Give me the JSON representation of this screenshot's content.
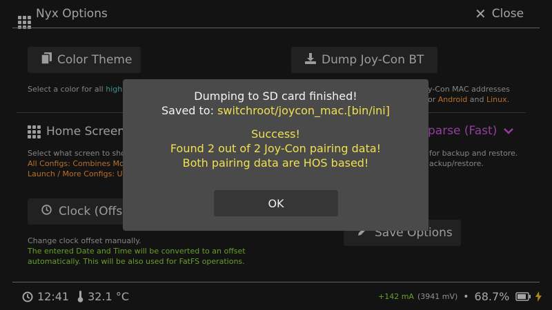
{
  "header": {
    "title": "Nyx Options",
    "close_label": "Close"
  },
  "buttons": {
    "color_theme": "Color Theme",
    "dump_joycon": "Dump Joy-Con BT",
    "home_screen": "Home Screen",
    "clock": "Clock (Offse",
    "save_options": "Save Options",
    "dropdown_value": "parse (Fast)"
  },
  "descriptions": {
    "color_prefix": "Select a color for all ",
    "color_highlight": "highli",
    "joycon_line1": "y-Con MAC addresses",
    "joycon_line2_prefix": "or ",
    "joycon_android": "Android",
    "joycon_and": " and ",
    "joycon_linux": "Linux",
    "joycon_dot": ".",
    "home_line1": "Select what screen to sho",
    "home_line2": "All Configs: Combines Mor",
    "home_line3_a": "Launch / More Configs: ",
    "home_line3_b": "Us",
    "backup_line1": "for backup and restore.",
    "backup_line2": "ackup/restore.",
    "clock_line1": "Change clock offset manually.",
    "clock_line2": "The entered Date and Time will be converted to an offset",
    "clock_line3": "automatically. This will be also used for FatFS operations."
  },
  "dialog": {
    "line1": "Dumping to SD card finished!",
    "saved_prefix": "Saved to: ",
    "saved_path": "switchroot/joycon_mac.[bin/ini]",
    "success": "Success!",
    "found": "Found 2 out of 2 Joy-Con pairing data!",
    "both": "Both pairing data are HOS based!",
    "ok_label": "OK"
  },
  "status": {
    "time": "12:41",
    "temperature": "32.1 °C",
    "current": "+142 mA",
    "voltage": "(3941 mV)",
    "battery": "68.7%"
  },
  "colors": {
    "background": "#1b1b1b",
    "dialog": "#4a4a4a",
    "success_text": "#f0e050",
    "path_text": "#f0e050",
    "accent_magenta": "#cc55dd",
    "charge_green": "#8fdc3a"
  }
}
